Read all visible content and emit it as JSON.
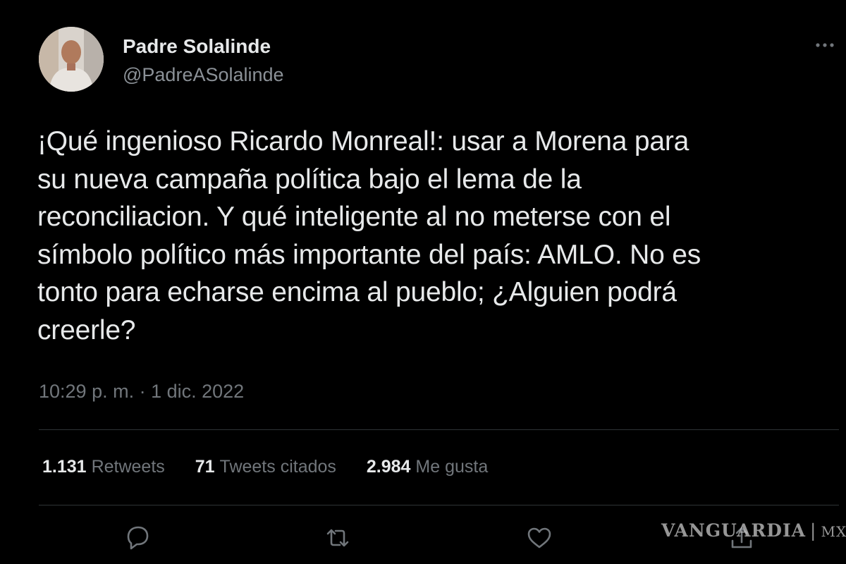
{
  "author": {
    "display_name": "Padre Solalinde",
    "handle": "@PadreASolalinde"
  },
  "tweet": {
    "text": "¡Qué ingenioso Ricardo Monreal!: usar a Morena para\nsu nueva campaña política bajo el lema de la\nreconciliacion. Y qué inteligente al no meterse con el\nsímbolo político más importante del país: AMLO. No es\ntonto para echarse encima al pueblo; ¿Alguien podrá\ncreerle?",
    "timestamp": "10:29 p. m. · 1 dic. 2022"
  },
  "stats": {
    "retweets": {
      "count": "1.131",
      "label": "Retweets"
    },
    "quotes": {
      "count": "71",
      "label": "Tweets citados"
    },
    "likes": {
      "count": "2.984",
      "label": "Me gusta"
    }
  },
  "actions": {
    "reply_icon": "reply-icon",
    "retweet_icon": "retweet-icon",
    "like_icon": "heart-icon",
    "share_icon": "share-icon",
    "more_icon": "more-icon"
  },
  "watermark": {
    "brand": "VANGUARDIA",
    "suffix": "MX"
  },
  "colors": {
    "background": "#000000",
    "text_primary": "#e7e9ea",
    "text_secondary": "#71767b",
    "divider": "#2f3336"
  }
}
